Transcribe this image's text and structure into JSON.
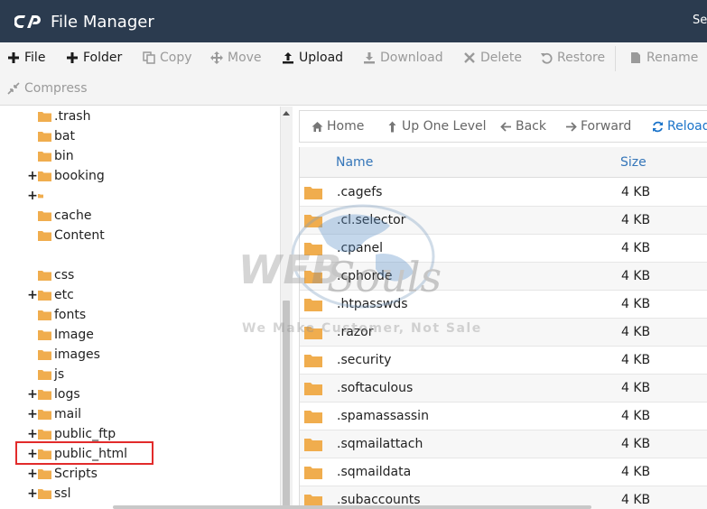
{
  "header": {
    "title": "File Manager",
    "right_text": "Se"
  },
  "toolbar": {
    "file": "File",
    "folder": "Folder",
    "copy": "Copy",
    "move": "Move",
    "upload": "Upload",
    "download": "Download",
    "delete": "Delete",
    "restore": "Restore",
    "rename": "Rename",
    "compress": "Compress"
  },
  "tree": {
    "items": [
      {
        "label": ".trash",
        "expandable": false
      },
      {
        "label": "bat",
        "expandable": false
      },
      {
        "label": "bin",
        "expandable": false
      },
      {
        "label": "booking",
        "expandable": true
      },
      {
        "label": "",
        "expandable": true
      },
      {
        "label": "cache",
        "expandable": false
      },
      {
        "label": "Content",
        "expandable": false
      },
      {
        "label": "css",
        "expandable": false
      },
      {
        "label": "etc",
        "expandable": true
      },
      {
        "label": "fonts",
        "expandable": false
      },
      {
        "label": "Image",
        "expandable": false
      },
      {
        "label": "images",
        "expandable": false
      },
      {
        "label": "js",
        "expandable": false
      },
      {
        "label": "logs",
        "expandable": true
      },
      {
        "label": "mail",
        "expandable": true
      },
      {
        "label": "public_ftp",
        "expandable": true
      },
      {
        "label": "public_html",
        "expandable": true
      },
      {
        "label": "Scripts",
        "expandable": true
      },
      {
        "label": "ssl",
        "expandable": true
      }
    ]
  },
  "nav": {
    "home": "Home",
    "up": "Up One Level",
    "back": "Back",
    "forward": "Forward",
    "reload": "Reload"
  },
  "table": {
    "col_name": "Name",
    "col_size": "Size",
    "rows": [
      {
        "name": ".cagefs",
        "size": "4 KB"
      },
      {
        "name": ".cl.selector",
        "size": "4 KB"
      },
      {
        "name": ".cpanel",
        "size": "4 KB"
      },
      {
        "name": ".cphorde",
        "size": "4 KB"
      },
      {
        "name": ".htpasswds",
        "size": "4 KB"
      },
      {
        "name": ".razor",
        "size": "4 KB"
      },
      {
        "name": ".security",
        "size": "4 KB"
      },
      {
        "name": ".softaculous",
        "size": "4 KB"
      },
      {
        "name": ".spamassassin",
        "size": "4 KB"
      },
      {
        "name": ".sqmailattach",
        "size": "4 KB"
      },
      {
        "name": ".sqmaildata",
        "size": "4 KB"
      },
      {
        "name": ".subaccounts",
        "size": "4 KB"
      }
    ]
  },
  "watermark": {
    "brand_web": "WEB",
    "brand_souls": "Souls",
    "tagline": "We Make Customer, Not Sale"
  },
  "colors": {
    "header_bg": "#2b3b4f",
    "folder": "#f0ad4e",
    "link_blue": "#3576b9",
    "highlight_red": "#e22b2b"
  },
  "icons": {
    "logo": "cpanel-logo",
    "file": "plus-icon",
    "folder": "plus-icon",
    "copy": "copy-icon",
    "move": "move-arrows-icon",
    "upload": "upload-icon",
    "download": "download-icon",
    "delete": "x-icon",
    "restore": "undo-icon",
    "rename": "file-icon",
    "compress": "compress-icon",
    "home": "home-icon",
    "up": "level-up-icon",
    "back": "arrow-left-icon",
    "forward": "arrow-right-icon",
    "reload": "refresh-icon",
    "tree_folder": "folder-icon"
  }
}
